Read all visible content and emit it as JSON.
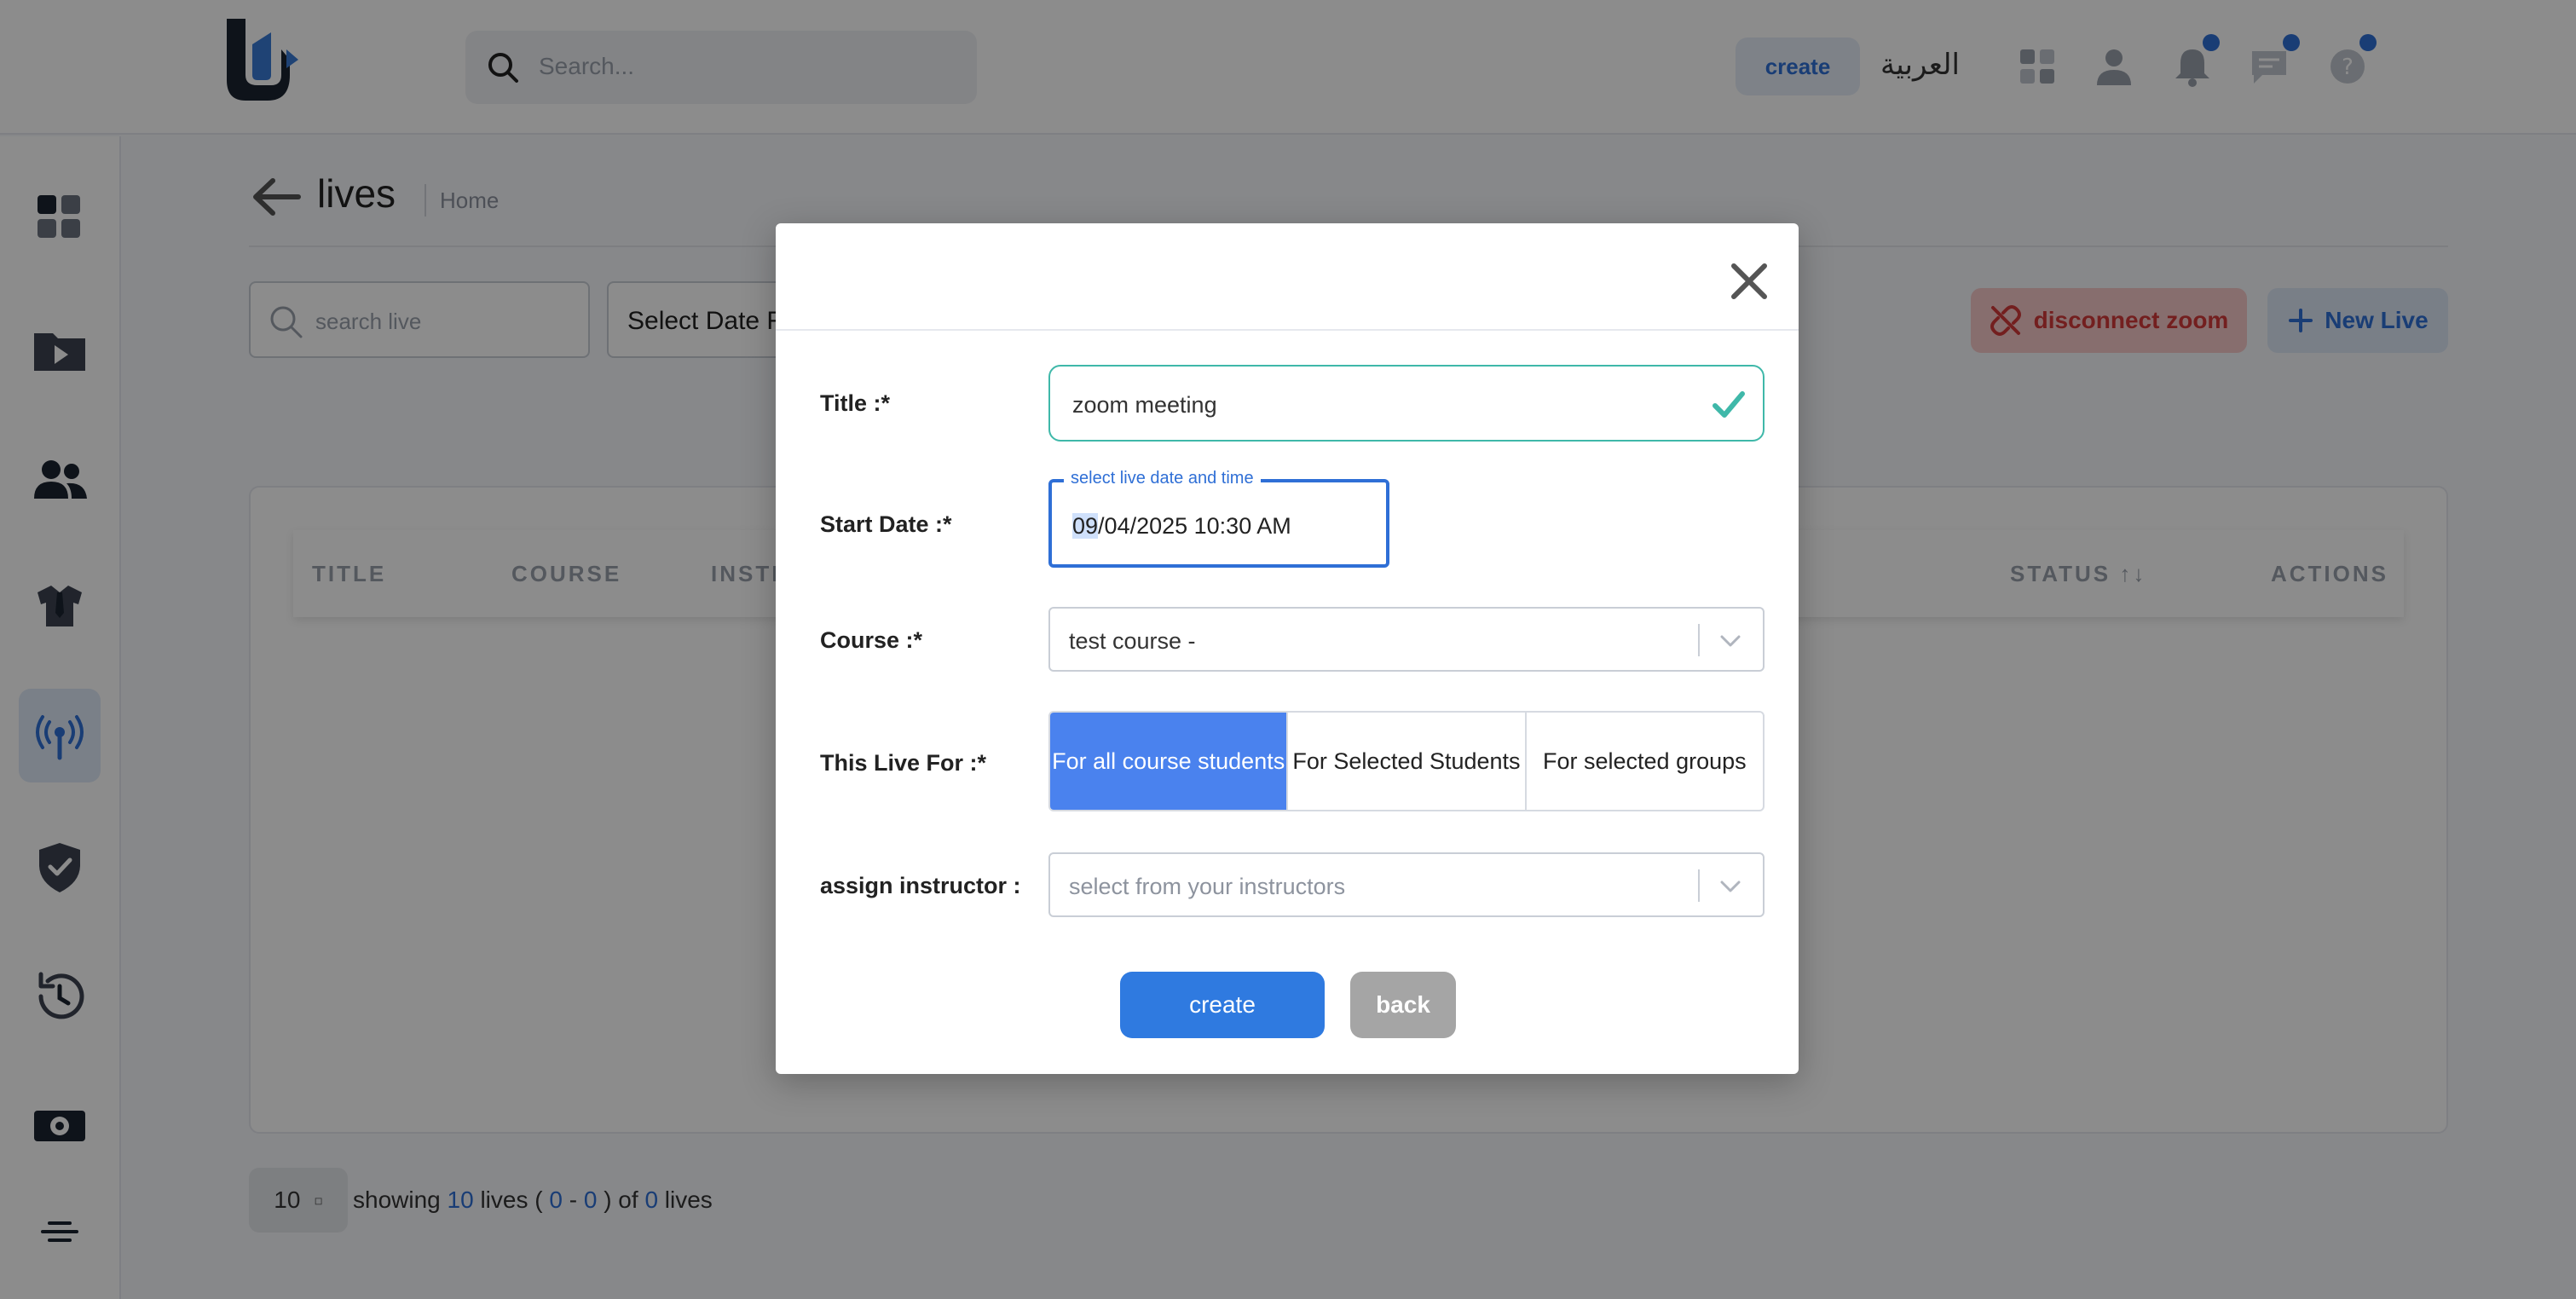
{
  "header": {
    "search_placeholder": "Search...",
    "create_label": "create",
    "language_label": "العربية",
    "icons": [
      "apps-icon",
      "user-icon",
      "bell-icon",
      "chat-icon",
      "help-icon"
    ]
  },
  "sidebar": {
    "items": [
      {
        "name": "dashboard-icon",
        "active": false
      },
      {
        "name": "video-folder-icon",
        "active": false
      },
      {
        "name": "users-icon",
        "active": false
      },
      {
        "name": "instructor-icon",
        "active": false
      },
      {
        "name": "live-broadcast-icon",
        "active": true
      },
      {
        "name": "shield-check-icon",
        "active": false
      },
      {
        "name": "history-icon",
        "active": false
      },
      {
        "name": "money-icon",
        "active": false
      },
      {
        "name": "menu-icon",
        "active": false
      }
    ]
  },
  "page": {
    "title": "lives",
    "breadcrumb": "Home",
    "search_placeholder": "search live",
    "date_range_label": "Select Date Range",
    "disconnect_label": "disconnect zoom",
    "new_live_label": "New Live",
    "columns": [
      "TITLE",
      "COURSE",
      "INSTRUCTOR",
      "STATUS ↑↓",
      "ACTIONS"
    ]
  },
  "pagination": {
    "per_page": "10",
    "showing": "showing",
    "count": "10",
    "lives_word": "lives",
    "open": "(",
    "from": "0",
    "dash": "-",
    "to": "0",
    "close_of": ") of",
    "total": "0",
    "lives_word_end": "lives"
  },
  "modal": {
    "title_label": "Title :*",
    "title_value": "zoom meeting",
    "start_date_label": "Start Date :*",
    "date_legend": "select live date and time",
    "date_selected_part": "09",
    "date_rest": "/04/2025 10:30 AM",
    "course_label": "Course :*",
    "course_value": "test course -",
    "live_for_label": "This Live For :*",
    "live_for_options": [
      "For all course students",
      "For Selected Students",
      "For selected groups"
    ],
    "live_for_selected": "For all course students",
    "instructor_label": "assign instructor :",
    "instructor_placeholder": "select from your instructors",
    "create_label": "create",
    "back_label": "back"
  },
  "colors": {
    "accent": "#2f6fd6",
    "danger": "#d23a3a",
    "success": "#3fb8a9",
    "segment_active": "#4a82ee"
  }
}
